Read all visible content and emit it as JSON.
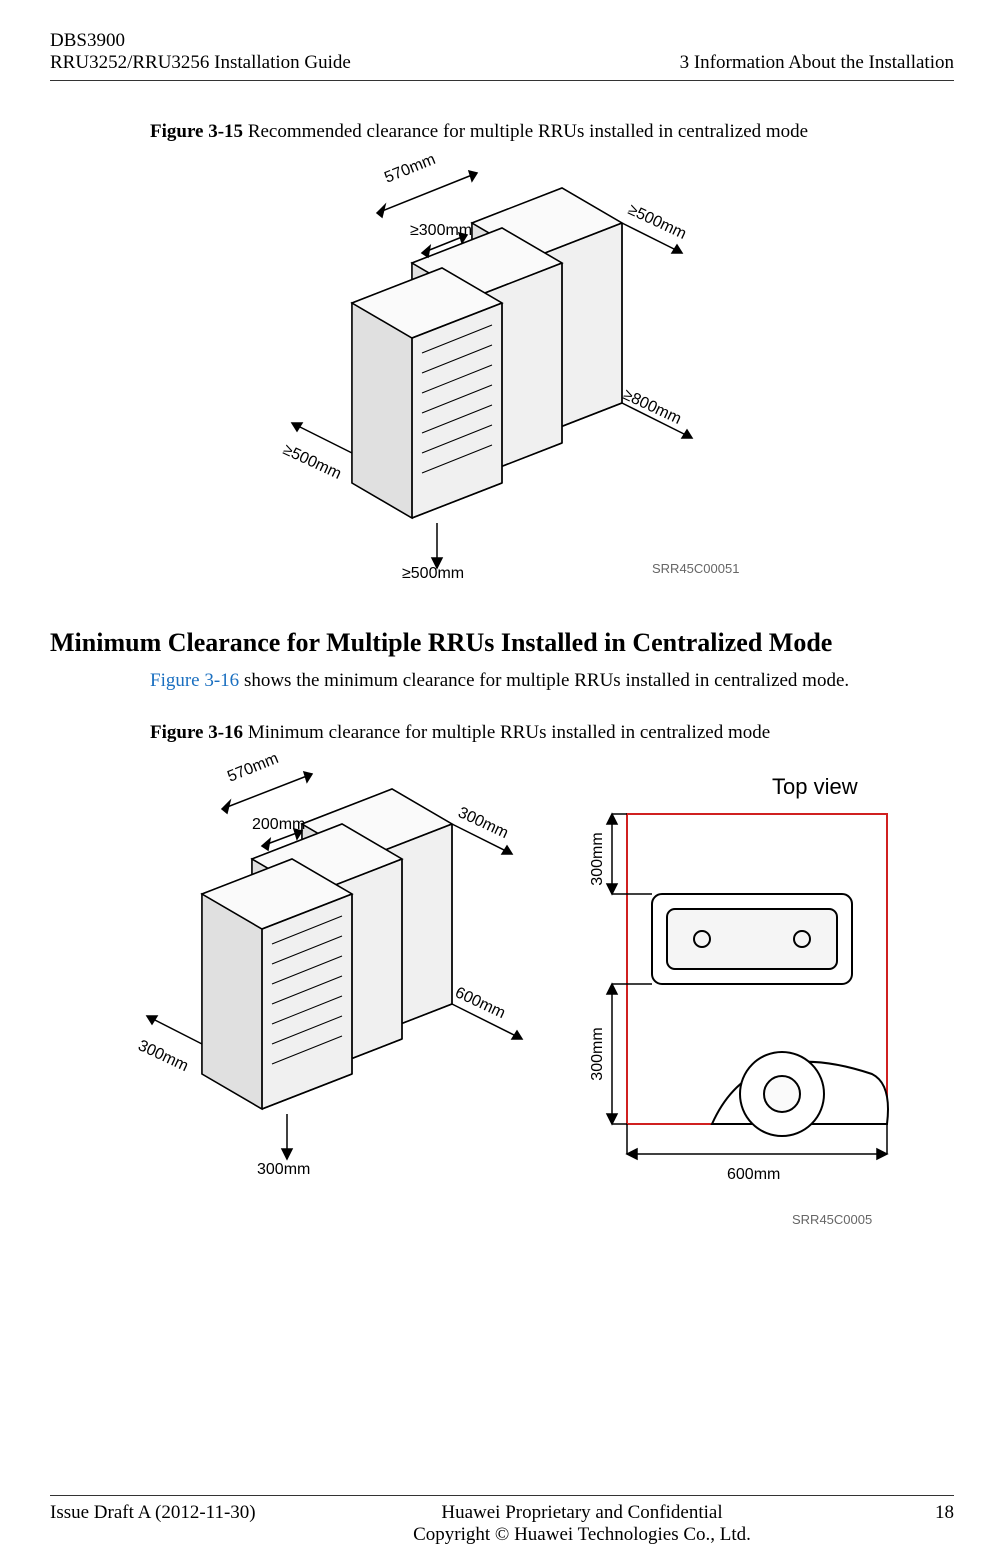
{
  "header": {
    "doc_model": "DBS3900",
    "doc_title": "RRU3252/RRU3256 Installation Guide",
    "chapter": "3 Information About the Installation"
  },
  "figure15": {
    "label": "Figure 3-15",
    "caption": " Recommended clearance for multiple RRUs installed in centralized mode",
    "dim_top_depth": "570mm",
    "dim_spacing": "≥300mm",
    "dim_right_top": "≥500mm",
    "dim_right_bottom": "≥800mm",
    "dim_left": "≥500mm",
    "dim_bottom": "≥500mm",
    "figure_code": "SRR45C00051"
  },
  "section": {
    "heading": "Minimum Clearance for Multiple RRUs Installed in Centralized Mode",
    "link_text": "Figure 3-16",
    "body_after_link": " shows the minimum clearance for multiple RRUs installed in centralized mode."
  },
  "figure16": {
    "label": "Figure 3-16",
    "caption": " Minimum clearance for multiple RRUs installed in centralized mode",
    "top_view_label": "Top view",
    "dim_top_depth": "570mm",
    "dim_spacing": "200mm",
    "dim_right_top": "300mm",
    "dim_right_bottom": "600mm",
    "dim_left": "300mm",
    "dim_bottom": "300mm",
    "tv_left_top": "300mm",
    "tv_left_bottom": "300mm",
    "tv_bottom": "600mm",
    "figure_code": "SRR45C0005"
  },
  "footer": {
    "issue": "Issue Draft A (2012-11-30)",
    "confidential": "Huawei Proprietary and Confidential",
    "copyright": "Copyright © Huawei Technologies Co., Ltd.",
    "page": "18"
  }
}
